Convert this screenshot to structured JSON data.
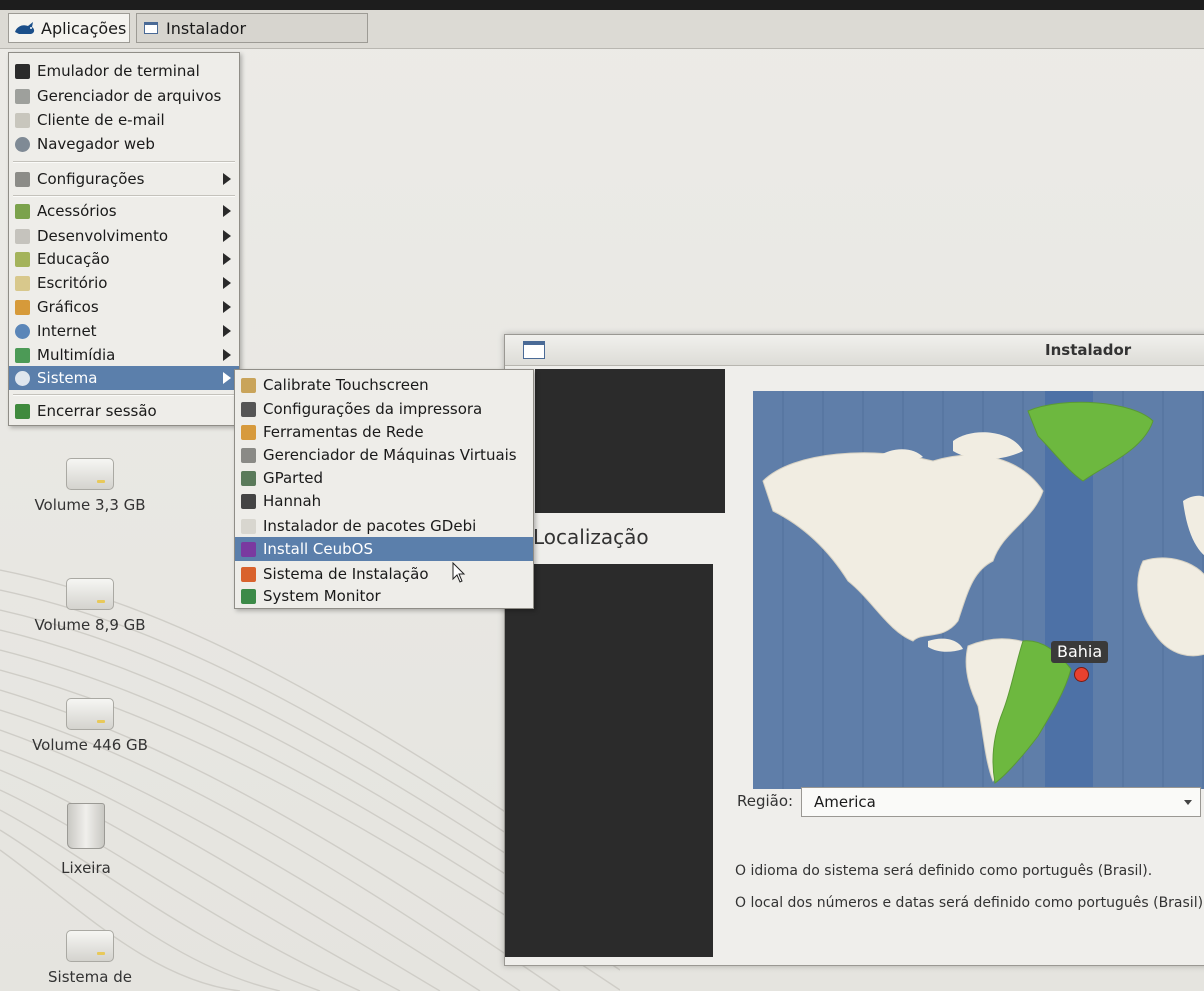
{
  "panel": {
    "apps_label": "Aplicações",
    "task_label": "Instalador"
  },
  "main_menu": {
    "items": [
      {
        "label": "Emulador de terminal",
        "icon": "terminal-icon",
        "color": "#2b2b2b",
        "submenu": false
      },
      {
        "label": "Gerenciador de arquivos",
        "icon": "file-manager-icon",
        "color": "#9ea09c",
        "submenu": false
      },
      {
        "label": "Cliente de e-mail",
        "icon": "mail-icon",
        "color": "#c8c6bd",
        "submenu": false
      },
      {
        "label": "Navegador web",
        "icon": "globe-icon",
        "color": "#7f8a95",
        "submenu": false
      },
      {
        "label": "Configurações",
        "icon": "settings-icon",
        "color": "#8c8c88",
        "submenu": true
      },
      {
        "label": "Acessórios",
        "icon": "accessories-icon",
        "color": "#7ba24c",
        "submenu": true
      },
      {
        "label": "Desenvolvimento",
        "icon": "development-icon",
        "color": "#c5c3bd",
        "submenu": true
      },
      {
        "label": "Educação",
        "icon": "education-icon",
        "color": "#a4b35b",
        "submenu": true
      },
      {
        "label": "Escritório",
        "icon": "office-icon",
        "color": "#d8c88c",
        "submenu": true
      },
      {
        "label": "Gráficos",
        "icon": "graphics-icon",
        "color": "#d69a3a",
        "submenu": true
      },
      {
        "label": "Internet",
        "icon": "internet-icon",
        "color": "#5b86b8",
        "submenu": true
      },
      {
        "label": "Multimídia",
        "icon": "multimedia-icon",
        "color": "#4c9a56",
        "submenu": true
      },
      {
        "label": "Sistema",
        "icon": "system-gear-icon",
        "color": "#dfe6ee",
        "submenu": true,
        "highlighted": true
      },
      {
        "label": "Encerrar sessão",
        "icon": "logout-icon",
        "color": "#3f8a3d",
        "submenu": false
      }
    ]
  },
  "sub_menu": {
    "items": [
      {
        "label": "Calibrate Touchscreen",
        "icon": "touchscreen-icon",
        "color": "#c9a45a"
      },
      {
        "label": "Configurações da impressora",
        "icon": "printer-icon",
        "color": "#555555"
      },
      {
        "label": "Ferramentas de Rede",
        "icon": "network-tools-icon",
        "color": "#d79a3c"
      },
      {
        "label": "Gerenciador de Máquinas Virtuais",
        "icon": "virtual-machine-icon",
        "color": "#8a8a86"
      },
      {
        "label": "GParted",
        "icon": "gparted-icon",
        "color": "#5a7a5a"
      },
      {
        "label": "Hannah",
        "icon": "hannah-icon",
        "color": "#444444"
      },
      {
        "label": "Instalador de pacotes GDebi",
        "icon": "package-icon",
        "color": "#d8d6cf"
      },
      {
        "label": "Install CeubOS",
        "icon": "ceubos-icon",
        "color": "#7a3aa0",
        "highlighted": true
      },
      {
        "label": "Sistema de Instalação",
        "icon": "installer-system-icon",
        "color": "#d9622d"
      },
      {
        "label": "System Monitor",
        "icon": "system-monitor-icon",
        "color": "#3c8a48"
      }
    ]
  },
  "desktop": {
    "icons": [
      {
        "label": "Volume 3,3 GB",
        "icon": "drive-icon"
      },
      {
        "label": "Volume 8,9 GB",
        "icon": "drive-icon"
      },
      {
        "label": "Volume 446 GB",
        "icon": "drive-icon"
      },
      {
        "label": "Lixeira",
        "icon": "trash-icon"
      },
      {
        "label": "Sistema de",
        "icon": "drive-icon"
      }
    ]
  },
  "installer": {
    "title": "Instalador",
    "step_heading": "Localização",
    "map_marker": "Bahia",
    "region_label": "Região:",
    "region_value": "America",
    "info_language": "O idioma do sistema será definido como português (Brasil).",
    "info_locale": "O local dos números e datas será definido como português (Brasil)."
  },
  "colors": {
    "menu_highlight": "#5b7fab",
    "ocean": "#5f7ea9",
    "land": "#f1ede2",
    "selected_timezone": "#6db83f",
    "timezone_band": "#4a6ea6"
  }
}
